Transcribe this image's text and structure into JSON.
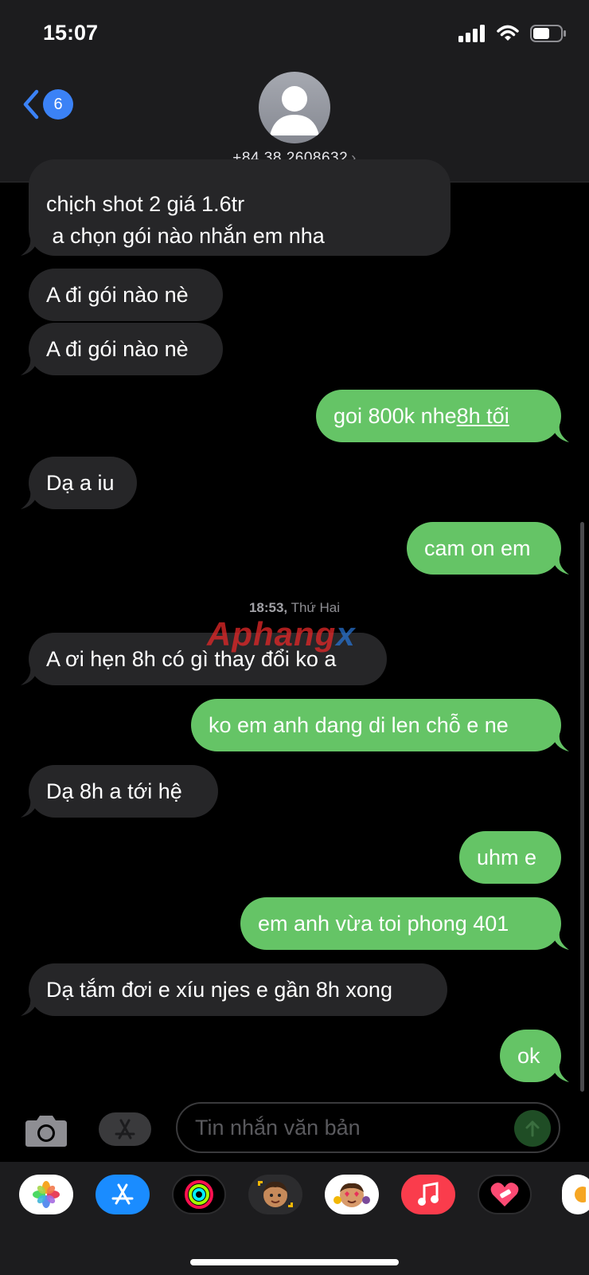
{
  "status": {
    "time": "15:07"
  },
  "nav": {
    "back_count": "6",
    "contact": "+84 38 2608632"
  },
  "messages": [
    {
      "dir": "in",
      "lines": [
        "chịch shot 2 giá 1.6tr",
        " a chọn gói nào nhắn em nha"
      ]
    },
    {
      "dir": "in",
      "text": "A đi gói nào nè"
    },
    {
      "dir": "in",
      "text": "A đi gói nào nè"
    },
    {
      "dir": "out",
      "text": "goi 800k nhe ",
      "link": "8h tối"
    },
    {
      "dir": "in",
      "text": "Dạ a iu"
    },
    {
      "dir": "out",
      "text": "cam on em"
    },
    {
      "dir": "in",
      "text": "A ơi hẹn 8h có gì thay đổi ko a"
    },
    {
      "dir": "out",
      "text": "ko em anh dang di len chỗ e ne"
    },
    {
      "dir": "in",
      "text": "Dạ 8h a tới hệ"
    },
    {
      "dir": "out",
      "text": "uhm e"
    },
    {
      "dir": "out",
      "text": "em anh vừa toi phong 401"
    },
    {
      "dir": "in",
      "text": "Dạ tắm đơi e xíu njes e gần 8h xong"
    },
    {
      "dir": "out",
      "text": "ok"
    }
  ],
  "timestamp": {
    "time": "18:53,",
    "day": "Thứ Hai"
  },
  "watermark": {
    "part1": "Aphang",
    "part2": "x"
  },
  "composer": {
    "placeholder": "Tin nhắn văn bản"
  },
  "dock_apps": [
    "photos-icon",
    "app-store-icon",
    "activity-icon",
    "memoji-sticker-icon",
    "animoji-icon",
    "music-icon",
    "heart-sticker-icon"
  ],
  "colors": {
    "incoming": "#262628",
    "outgoing": "#65c466",
    "accent": "#3b82f6"
  }
}
